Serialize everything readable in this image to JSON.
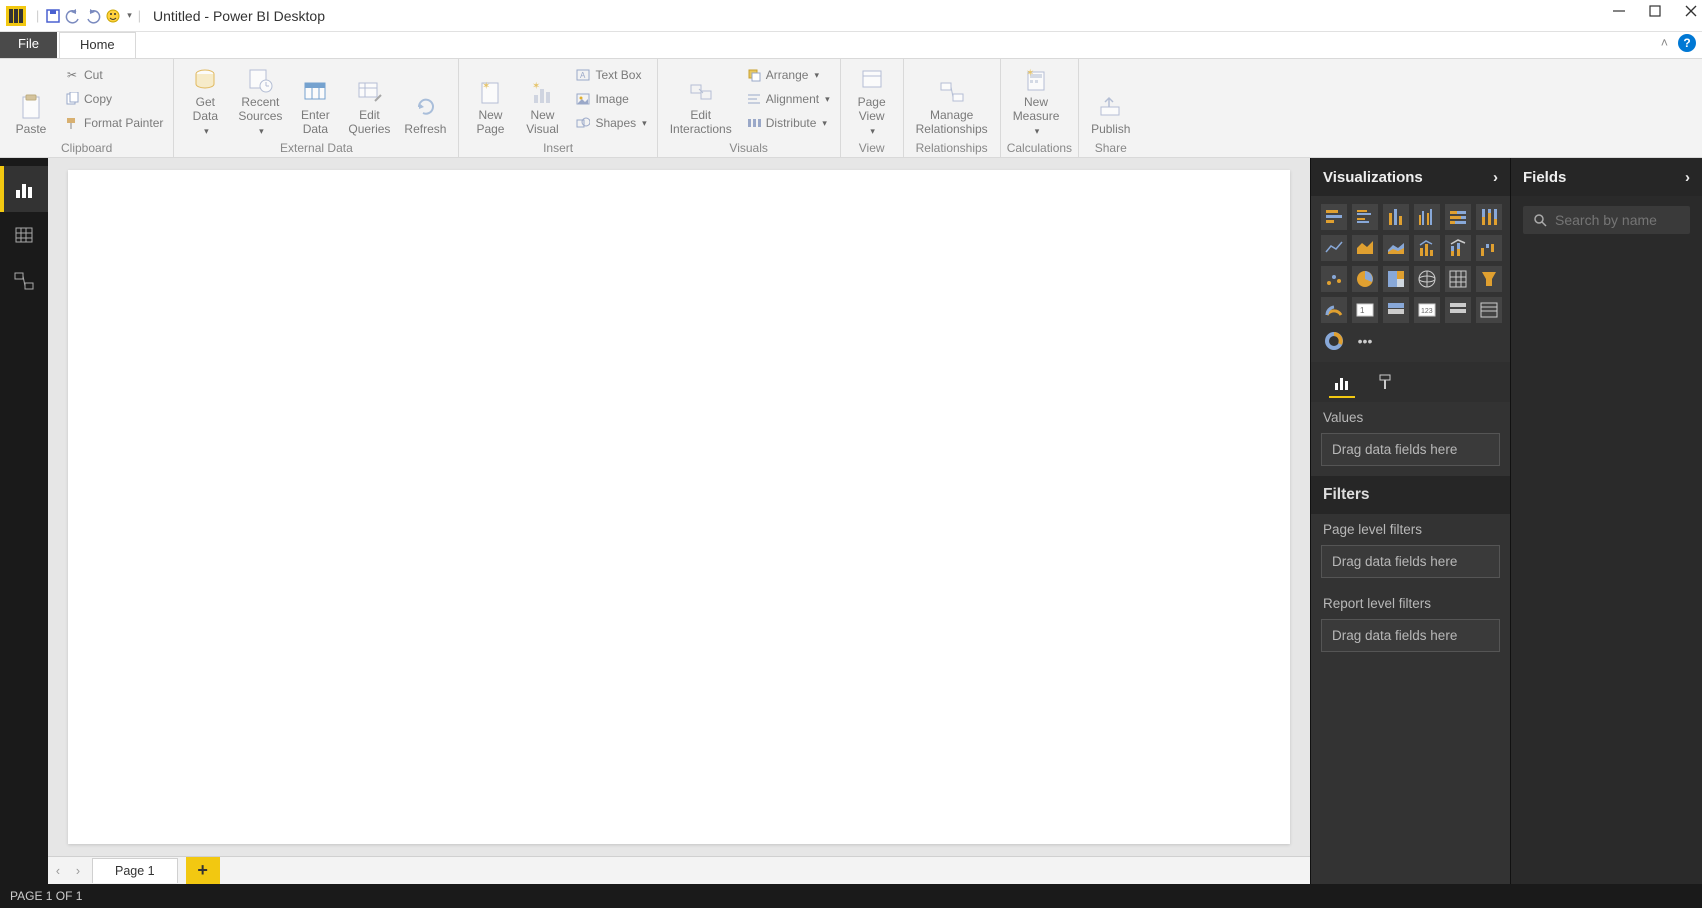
{
  "title": "Untitled - Power BI Desktop",
  "tabs": {
    "file": "File",
    "home": "Home"
  },
  "ribbon": {
    "clipboard": {
      "label": "Clipboard",
      "paste": "Paste",
      "cut": "Cut",
      "copy": "Copy",
      "format_painter": "Format Painter"
    },
    "external_data": {
      "label": "External Data",
      "get_data": "Get\nData",
      "recent_sources": "Recent\nSources",
      "enter_data": "Enter\nData",
      "edit_queries": "Edit\nQueries",
      "refresh": "Refresh"
    },
    "insert": {
      "label": "Insert",
      "new_page": "New\nPage",
      "new_visual": "New\nVisual",
      "text_box": "Text Box",
      "image": "Image",
      "shapes": "Shapes"
    },
    "visuals": {
      "label": "Visuals",
      "edit_interactions": "Edit\nInteractions",
      "arrange": "Arrange",
      "alignment": "Alignment",
      "distribute": "Distribute"
    },
    "view": {
      "label": "View",
      "page_view": "Page\nView"
    },
    "relationships": {
      "label": "Relationships",
      "manage": "Manage\nRelationships"
    },
    "calculations": {
      "label": "Calculations",
      "new_measure": "New\nMeasure"
    },
    "share": {
      "label": "Share",
      "publish": "Publish"
    }
  },
  "pages": {
    "page1": "Page 1"
  },
  "status": "PAGE 1 OF 1",
  "right": {
    "visualizations": "Visualizations",
    "values": "Values",
    "drag_fields": "Drag data fields here",
    "filters": "Filters",
    "page_filters": "Page level filters",
    "report_filters": "Report level filters",
    "fields": "Fields",
    "search_placeholder": "Search by name"
  }
}
